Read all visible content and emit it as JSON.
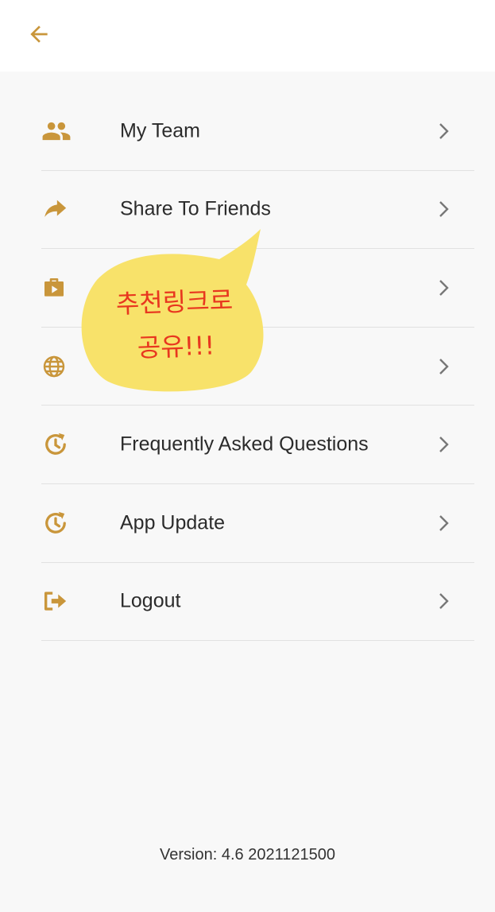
{
  "colors": {
    "accent": "#c9963b",
    "chevron": "#777777",
    "bubble": "#f8e26a",
    "bubble_text": "#e8371f"
  },
  "header": {
    "back_icon": "arrow-left-icon"
  },
  "menu": {
    "items": [
      {
        "label": "My Team",
        "icon": "people-icon"
      },
      {
        "label": "Share To Friends",
        "icon": "share-icon"
      },
      {
        "label": "",
        "icon": "video-briefcase-icon"
      },
      {
        "label": "",
        "icon": "globe-icon"
      },
      {
        "label": "Frequently Asked Questions",
        "icon": "clock-refresh-icon"
      },
      {
        "label": "App Update",
        "icon": "clock-refresh-icon"
      },
      {
        "label": "Logout",
        "icon": "logout-icon"
      }
    ]
  },
  "annotation": {
    "line1": "추천링크로",
    "line2": "공유!!!"
  },
  "footer": {
    "version": "Version: 4.6 2021121500"
  }
}
